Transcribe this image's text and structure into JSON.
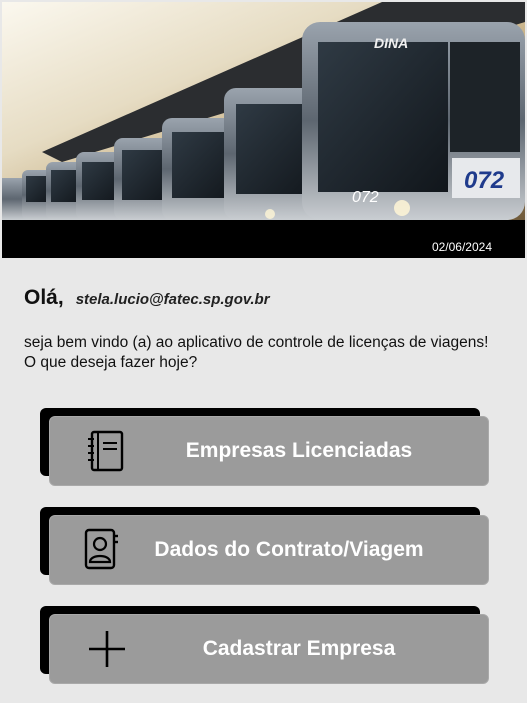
{
  "header": {
    "date": "02/06/2024"
  },
  "greeting": {
    "hello": "Olá,",
    "email": "stela.lucio@fatec.sp.gov.br",
    "welcome": "seja bem vindo (a) ao aplicativo de controle de licenças de viagens! O que deseja fazer hoje?"
  },
  "actions": [
    {
      "label": "Empresas Licenciadas",
      "icon": "notebook-icon"
    },
    {
      "label": "Dados do Contrato/Viagem",
      "icon": "contact-book-icon"
    },
    {
      "label": "Cadastrar Empresa",
      "icon": "plus-icon"
    }
  ],
  "colors": {
    "background": "#e8e8e8",
    "button": "#9b9b9b",
    "button_shadow": "#000000",
    "date_bar": "#000000"
  }
}
